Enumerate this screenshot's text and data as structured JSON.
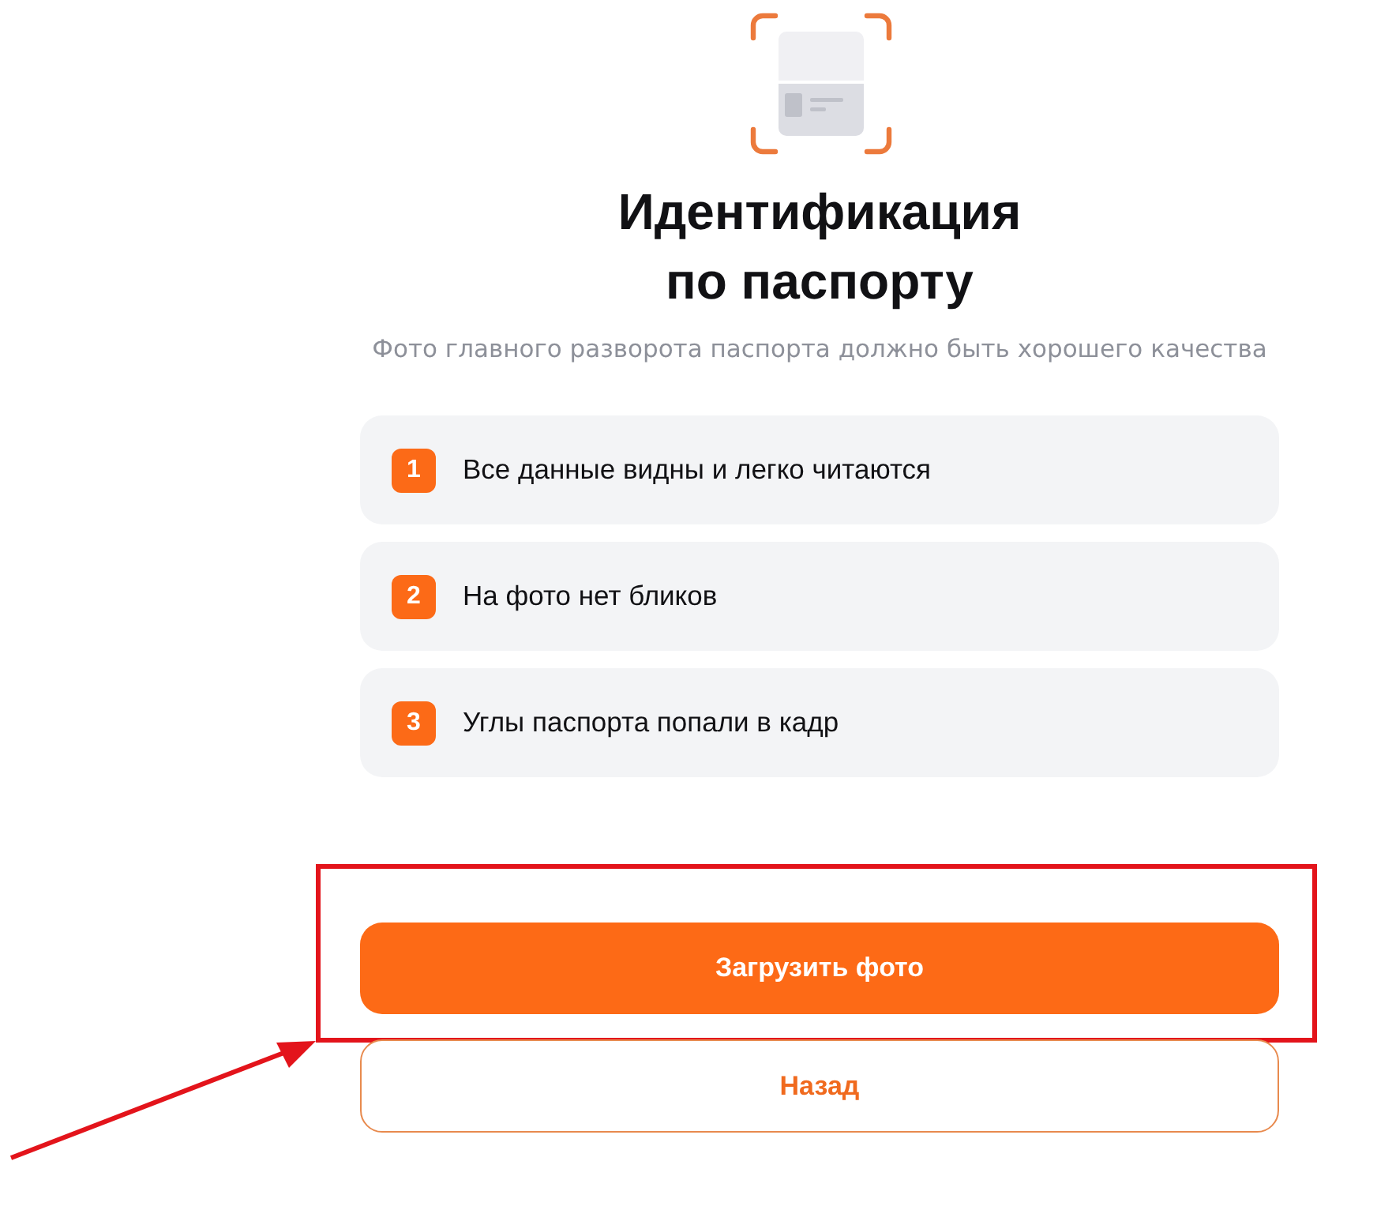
{
  "header": {
    "title_lines": [
      "Идентификация",
      "по паспорту"
    ],
    "subtitle": "Фото главного разворота паспорта должно быть хорошего качества"
  },
  "requirements": [
    {
      "number": "1",
      "text": "Все данные видны и легко читаются"
    },
    {
      "number": "2",
      "text": "На фото нет бликов"
    },
    {
      "number": "3",
      "text": "Углы паспорта попали в кадр"
    }
  ],
  "buttons": [
    {
      "kind": "primary",
      "label": "Загрузить фото",
      "highlighted": true
    },
    {
      "kind": "secondary",
      "label": "Назад",
      "highlighted": false
    }
  ]
}
